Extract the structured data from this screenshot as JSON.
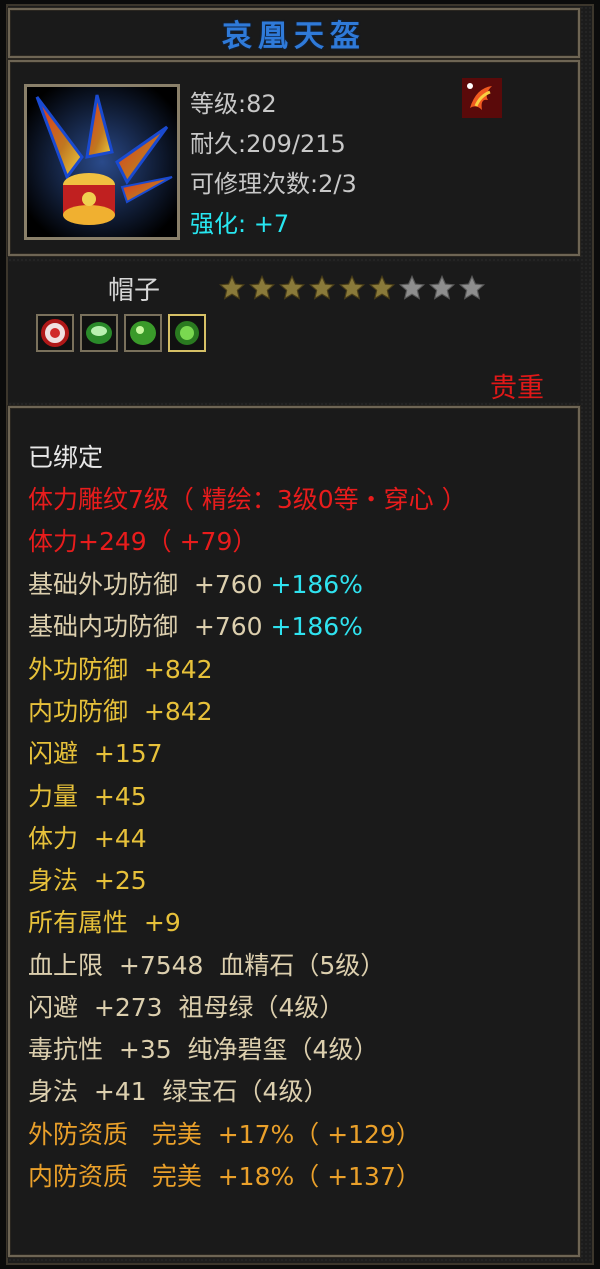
{
  "item": {
    "name": "哀凰天盔",
    "level": "等级:82",
    "durability": "耐久:209/215",
    "repairs": "可修理次数:2/3",
    "enhance_label": "强化:",
    "enhance_value": " +7",
    "type": "帽子",
    "stars_filled": 6,
    "stars_total": 9,
    "grade": "贵重"
  },
  "gems": [
    "red-gem-icon",
    "green-gem-icon",
    "green-gem-icon",
    "green-gem-icon"
  ],
  "attributes": {
    "bound": "已绑定",
    "engrave": "体力雕纹7级（ 精绘：3级0等・穿心 ）",
    "stamina_total": "体力+249（ +79）",
    "base_outer_def": "基础外功防御  +760 ",
    "base_outer_def_pct": "+186%",
    "base_inner_def": "基础内功防御  +760 ",
    "base_inner_def_pct": "+186%",
    "outer_def": "外功防御  +842",
    "inner_def": "内功防御  +842",
    "dodge": "闪避  +157",
    "strength": "力量  +45",
    "stamina": "体力  +44",
    "agility": "身法  +25",
    "all_attr": "所有属性  +9",
    "gem1": "血上限  +7548  血精石（5级）",
    "gem2": "闪避  +273  祖母绿（4级）",
    "gem3": "毒抗性  +35  纯净碧玺（4级）",
    "gem4": "身法  +41  绿宝石（4级）",
    "quality1": "外防资质   完美  +17%（ +129）",
    "quality2": "内防资质   完美  +18%（ +137）"
  },
  "colors": {
    "title": "#2f7ad9",
    "enhance": "#27e6f0",
    "grade": "#e01818",
    "star_filled": "#8a7a3a",
    "star_empty": "#8e8e8e"
  }
}
